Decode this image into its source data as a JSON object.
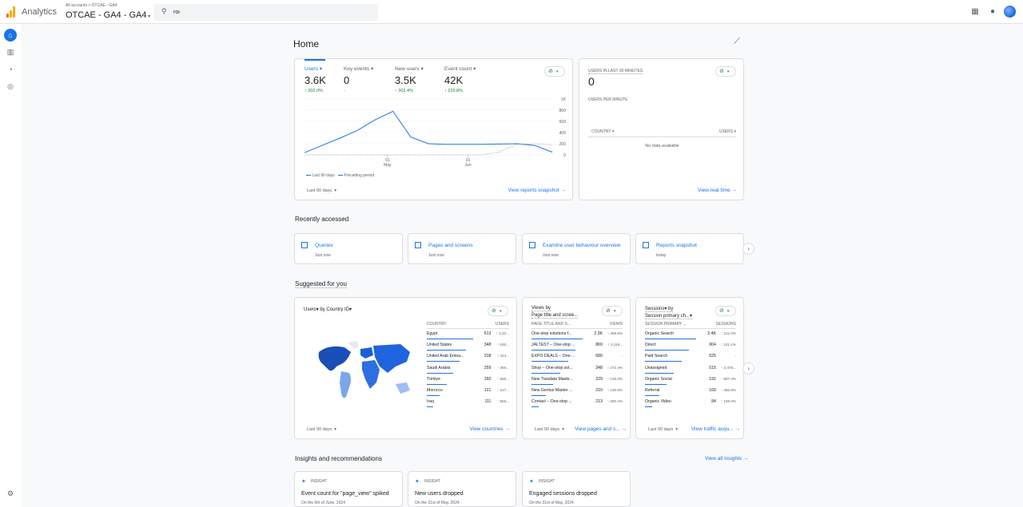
{
  "header": {
    "app_name": "Analytics",
    "breadcrumb": "All accounts > OTCAE - GA4",
    "property": "OTCAE - GA4 - GA4",
    "search_value": "roi"
  },
  "page": {
    "title": "Home"
  },
  "overview": {
    "metrics": [
      {
        "label": "Users",
        "value": "3.6K",
        "delta": "↑ 302.0%"
      },
      {
        "label": "Key events",
        "value": "0",
        "delta": "-"
      },
      {
        "label": "New users",
        "value": "3.5K",
        "delta": "↑ 302.4%"
      },
      {
        "label": "Event count",
        "value": "42K",
        "delta": "↑ 229.8%"
      }
    ],
    "y_ticks": [
      "1K",
      "800",
      "600",
      "400",
      "200",
      "0"
    ],
    "x_ticks": [
      {
        "day": "01",
        "month": "May"
      },
      {
        "day": "01",
        "month": "Jun"
      }
    ],
    "legend_current": "Last 90 days",
    "legend_previous": "Preceding period",
    "date_range": "Last 90 days",
    "link": "View reports snapshot"
  },
  "realtime": {
    "title": "USERS IN LAST 30 MINUTES",
    "value": "0",
    "subtitle": "USERS PER MINUTE",
    "col_country": "COUNTRY",
    "col_users": "USERS",
    "empty": "No data available",
    "link": "View real time"
  },
  "recent": {
    "title": "Recently accessed",
    "items": [
      {
        "title": "Queries",
        "time": "Just now"
      },
      {
        "title": "Pages and screens",
        "time": "Just now"
      },
      {
        "title": "Examine user behaviour overview",
        "time": "Just now"
      },
      {
        "title": "Reports snapshot",
        "time": "today"
      }
    ]
  },
  "suggested": {
    "title": "Suggested for you",
    "countries": {
      "title": "Users▾ by Country ID▾",
      "col1": "COUNTRY",
      "col2": "USERS",
      "rows": [
        {
          "name": "Egypt",
          "value": "613",
          "delta": "↑ 1,32..."
        },
        {
          "name": "United States",
          "value": "348",
          "delta": "↑ 190..."
        },
        {
          "name": "United Arab Emira...",
          "value": "318",
          "delta": "↑ 224..."
        },
        {
          "name": "Saudi Arabia",
          "value": "259",
          "delta": "↑ 260..."
        },
        {
          "name": "Türkiye",
          "value": "160",
          "delta": "↑ 566..."
        },
        {
          "name": "Morocco",
          "value": "121",
          "delta": "↑ 217..."
        },
        {
          "name": "Iraq",
          "value": "111",
          "delta": "↑ 555..."
        }
      ],
      "date_range": "Last 90 days",
      "link": "View countries"
    },
    "pages": {
      "title_line1": "Views by",
      "title_line2": "Page title and scree...",
      "col1": "PAGE TITLE AND S...",
      "col2": "VIEWS",
      "rows": [
        {
          "name": "One-stop solutions f...",
          "value": "2.3K",
          "delta": "↑ 498.9%"
        },
        {
          "name": "JALTEST – One-stop ...",
          "value": "869",
          "delta": "↑ 3,119..."
        },
        {
          "name": "EXPO DEALS – One-...",
          "value": "680",
          "delta": "-"
        },
        {
          "name": "Shop – One-stop sol...",
          "value": "348",
          "delta": "↑ 272.4%"
        },
        {
          "name": "New Trasdata Maste...",
          "value": "229",
          "delta": "↑ 126.0%"
        },
        {
          "name": "New Genius Master ...",
          "value": "210",
          "delta": "↑ 130.8%"
        },
        {
          "name": "Contact – One-stop ...",
          "value": "213",
          "delta": "↑ 280.4%"
        }
      ],
      "date_range": "Last 90 days",
      "link": "View pages and s..."
    },
    "sessions": {
      "title_line1": "Sessions▾ by",
      "title_line2": "Session primary ch...▾",
      "col1": "SESSION PRIMARY ...",
      "col2": "SESSIONS",
      "rows": [
        {
          "name": "Organic Search",
          "value": "2.4K",
          "delta": "↑ 211.0%"
        },
        {
          "name": "Direct",
          "value": "904",
          "delta": "↑ 241.1%"
        },
        {
          "name": "Paid Search",
          "value": "625",
          "delta": "-"
        },
        {
          "name": "Unassigned",
          "value": "515",
          "delta": "↑ 2,476..."
        },
        {
          "name": "Organic Social",
          "value": "191",
          "delta": "↑ 807.4%"
        },
        {
          "name": "Referral",
          "value": "169",
          "delta": "↑ 482.8%"
        },
        {
          "name": "Organic Video",
          "value": "84",
          "delta": "↑ 100.0%"
        }
      ],
      "date_range": "Last 90 days",
      "link": "View traffic acqu..."
    }
  },
  "insights": {
    "title": "Insights and recommendations",
    "link": "View all insights →",
    "cards": [
      {
        "tag": "INSIGHT",
        "title": "Event count for \"page_view\" spiked",
        "date": "On the 6th of June, 2024"
      },
      {
        "tag": "INSIGHT",
        "title": "New users dropped",
        "date": "On the 31st of May, 2024"
      },
      {
        "tag": "INSIGHT",
        "title": "Engaged sessions dropped",
        "date": "On the 31st of May, 2024"
      }
    ]
  },
  "colors": {
    "accent": "#1a73e8",
    "positive": "#188038",
    "logo_orange": "#f9ab00",
    "logo_dark": "#e37400"
  },
  "icons": [
    "apps-icon",
    "help-icon",
    "home-icon",
    "reports-icon",
    "explore-icon",
    "advertising-icon",
    "settings-icon",
    "search-icon",
    "insights-trend-icon",
    "check-circle-icon",
    "sparkle-icon",
    "chevron-right-icon"
  ],
  "chart_data": {
    "type": "line",
    "xlabel": "",
    "ylabel": "",
    "ylim": [
      0,
      1000
    ],
    "x": [
      "early Apr",
      "",
      "",
      "",
      "",
      "late Apr",
      "01 May",
      "",
      "",
      "",
      "01 Jun",
      "",
      "",
      "late Jun"
    ],
    "series": [
      {
        "name": "Last 90 days",
        "values": [
          40,
          170,
          300,
          440,
          630,
          780,
          320,
          200,
          190,
          190,
          190,
          195,
          200,
          170,
          50
        ]
      },
      {
        "name": "Preceding period",
        "values": [
          0,
          0,
          0,
          0,
          0,
          0,
          0,
          0,
          0,
          0,
          0,
          50,
          190,
          200,
          180
        ]
      }
    ]
  }
}
